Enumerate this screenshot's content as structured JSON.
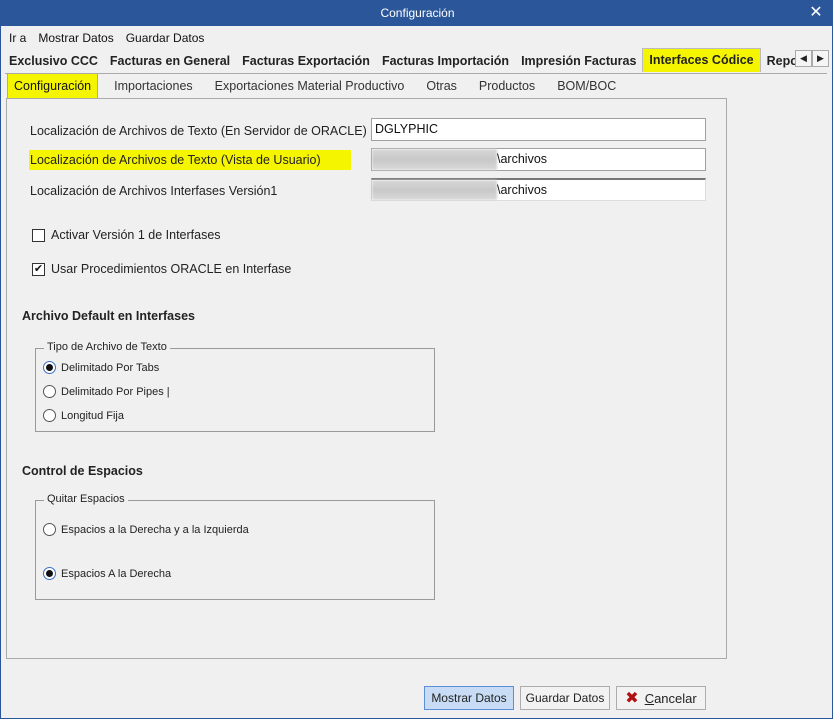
{
  "window": {
    "title": "Configuración",
    "close_icon": "close-icon"
  },
  "menu": {
    "items": [
      "Ir a",
      "Mostrar Datos",
      "Guardar Datos"
    ]
  },
  "main_tabs": {
    "items": [
      {
        "label": "Exclusivo CCC",
        "active": false
      },
      {
        "label": "Facturas en General",
        "active": false
      },
      {
        "label": "Facturas Exportación",
        "active": false
      },
      {
        "label": "Facturas Importación",
        "active": false
      },
      {
        "label": "Impresión Facturas",
        "active": false
      },
      {
        "label": "Interfaces Códice",
        "active": true
      },
      {
        "label": "Reportes",
        "active": false
      }
    ],
    "scroll_left_icon": "◀",
    "scroll_right_icon": "▶"
  },
  "sub_tabs": {
    "items": [
      {
        "label": "Configuración",
        "active": true
      },
      {
        "label": "Importaciones",
        "active": false
      },
      {
        "label": "Exportaciones Material Productivo",
        "active": false
      },
      {
        "label": "Otras",
        "active": false
      },
      {
        "label": "Productos",
        "active": false
      },
      {
        "label": "BOM/BOC",
        "active": false
      }
    ]
  },
  "config": {
    "fields": [
      {
        "label": "Localización de Archivos de Texto (En Servidor de ORACLE)",
        "value": "DGLYPHIC",
        "redacted": false
      },
      {
        "label": "Localización de Archivos de Texto (Vista de Usuario)",
        "value": "\\archivos",
        "redacted": true
      },
      {
        "label": "Localización de Archivos Interfases Versión1",
        "value": "\\archivos",
        "redacted": true
      }
    ],
    "checkboxes": [
      {
        "label": "Activar Versión 1 de Interfases",
        "checked": false
      },
      {
        "label": "Usar Procedimientos ORACLE en Interfase",
        "checked": true
      }
    ],
    "check_mark": "✔"
  },
  "archivo_default": {
    "title": "Archivo Default en Interfases",
    "group_label": "Tipo de Archivo de Texto",
    "options": [
      {
        "label": "Delimitado Por Tabs",
        "selected": true
      },
      {
        "label": "Delimitado Por Pipes |",
        "selected": false
      },
      {
        "label": "Longitud Fija",
        "selected": false
      }
    ]
  },
  "control_espacios": {
    "title": "Control de Espacios",
    "group_label": "Quitar Espacios",
    "options": [
      {
        "label": "Espacios a la Derecha y a la Izquierda",
        "selected": false
      },
      {
        "label": "Espacios A la Derecha",
        "selected": true
      }
    ]
  },
  "buttons": {
    "mostrar": "Mostrar Datos",
    "guardar": "Guardar Datos",
    "cancelar_first": "C",
    "cancelar_rest": "ancelar",
    "cancel_icon": "✖"
  }
}
